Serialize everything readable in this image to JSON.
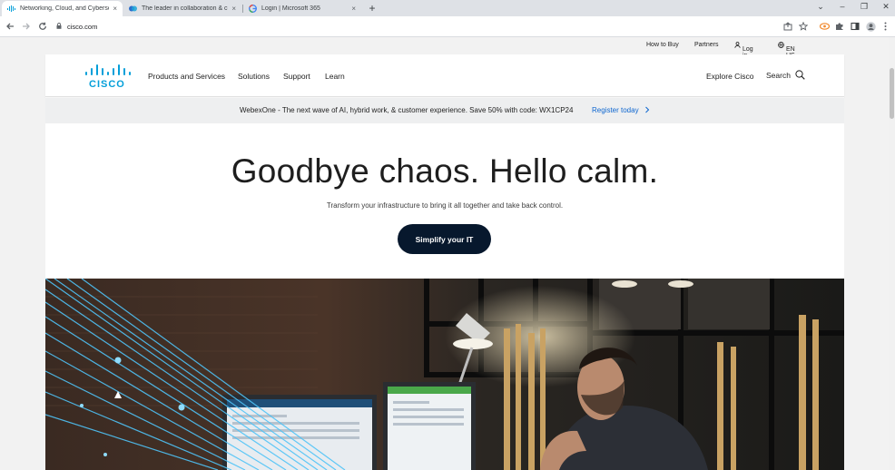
{
  "browser": {
    "tabs": [
      {
        "title": "Networking, Cloud, and Cyberse",
        "active": true,
        "icon": "cisco-favicon"
      },
      {
        "title": "The leader in collaboration & cu",
        "active": false,
        "icon": "webex-favicon"
      },
      {
        "title": "Login | Microsoft 365",
        "active": false,
        "icon": "google-favicon"
      }
    ],
    "close_glyph": "×",
    "new_tab_glyph": "+",
    "window_controls": {
      "minimize": "⌄",
      "restore": "–",
      "maximize": "❐",
      "close": "✕"
    },
    "address": "cisco.com",
    "lock_glyph": "🔒"
  },
  "utility_nav": {
    "how_to_buy": "How to Buy",
    "partners": "Partners",
    "login": "Log in",
    "language": "EN US"
  },
  "main_nav": {
    "logo_text": "CISCO",
    "items": [
      "Products and Services",
      "Solutions",
      "Support",
      "Learn"
    ],
    "explore": "Explore Cisco",
    "search": "Search"
  },
  "promo": {
    "message": "WebexOne - The next wave of AI, hybrid work, & customer experience. Save 50% with code: WX1CP24",
    "cta": "Register today"
  },
  "hero": {
    "title": "Goodbye chaos. Hello calm.",
    "subtitle": "Transform your infrastructure to bring it all together and take back control.",
    "button": "Simplify your IT"
  },
  "colors": {
    "cisco_blue": "#049fd9",
    "button_navy": "#07182d",
    "link_blue": "#0d66d0"
  }
}
